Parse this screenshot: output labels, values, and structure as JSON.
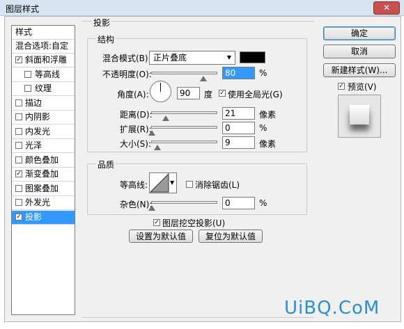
{
  "window": {
    "title": "图层样式",
    "close_label": "✕"
  },
  "colors": {
    "selection": "#3399ff",
    "blend_color": "#000000"
  },
  "sidebar": {
    "header": "样式",
    "blend_options": "混合选项:自定",
    "items": [
      {
        "label": "斜面和浮雕",
        "checked": true,
        "sub": false
      },
      {
        "label": "等高线",
        "checked": false,
        "sub": true
      },
      {
        "label": "纹理",
        "checked": false,
        "sub": true
      },
      {
        "label": "描边",
        "checked": false,
        "sub": false
      },
      {
        "label": "内阴影",
        "checked": false,
        "sub": false
      },
      {
        "label": "内发光",
        "checked": false,
        "sub": false
      },
      {
        "label": "光泽",
        "checked": false,
        "sub": false
      },
      {
        "label": "颜色叠加",
        "checked": false,
        "sub": false
      },
      {
        "label": "渐变叠加",
        "checked": true,
        "sub": false
      },
      {
        "label": "图案叠加",
        "checked": false,
        "sub": false
      },
      {
        "label": "外发光",
        "checked": false,
        "sub": false
      },
      {
        "label": "投影",
        "checked": true,
        "sub": false,
        "selected": true
      }
    ]
  },
  "panel": {
    "title": "投影",
    "structure": {
      "legend": "结构",
      "blend_mode_label": "混合模式(B):",
      "blend_mode_value": "正片叠底",
      "opacity_label": "不透明度(O):",
      "opacity_value": "80",
      "opacity_level": 80,
      "percent": "%",
      "angle_label": "角度(A):",
      "angle_value": "90",
      "degree_unit": "度",
      "global_light_label": "使用全局光(G)",
      "global_light_checked": true,
      "distance_label": "距离(D):",
      "distance_value": "21",
      "distance_level": 21,
      "pixel_unit": "像素",
      "spread_label": "扩展(R):",
      "spread_value": "0",
      "spread_level": 0,
      "size_label": "大小(S):",
      "size_value": "9",
      "size_level": 9
    },
    "quality": {
      "legend": "品质",
      "contour_label": "等高线:",
      "antialias_label": "消除锯齿(L)",
      "antialias_checked": false,
      "noise_label": "杂色(N):",
      "noise_value": "0",
      "noise_level": 0,
      "percent": "%"
    },
    "knockout_label": "图层挖空投影(U)",
    "knockout_checked": true,
    "set_default_label": "设置为默认值",
    "reset_default_label": "复位为默认值"
  },
  "buttons": {
    "ok": "确定",
    "cancel": "取消",
    "new_style": "新建样式(W)...",
    "preview_label": "预览(V)",
    "preview_checked": true
  },
  "watermark": "UiBQ.CoM"
}
